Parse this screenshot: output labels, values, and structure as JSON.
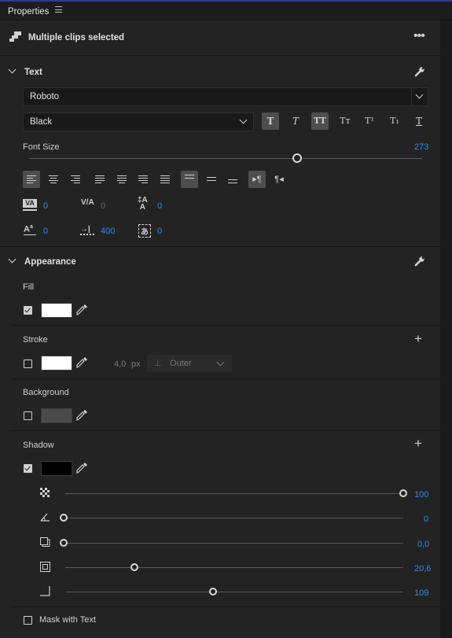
{
  "header": {
    "title": "Properties"
  },
  "selection": {
    "label": "Multiple clips selected"
  },
  "text_section": {
    "title": "Text",
    "font_family": "Roboto",
    "font_style": "Black",
    "style_buttons": [
      "T",
      "T",
      "TT",
      "Tт",
      "T¹",
      "T₁",
      "T"
    ],
    "font_size_label": "Font Size",
    "font_size_value": "273",
    "font_size_level": 0.63,
    "kerning": "0",
    "tracking": "0",
    "leading": "0",
    "baseline_shift": "0",
    "tab_width": "400",
    "tsume": "0"
  },
  "appearance": {
    "title": "Appearance",
    "fill": {
      "label": "Fill",
      "checked": true,
      "color": "#ffffff"
    },
    "stroke": {
      "label": "Stroke",
      "checked": false,
      "color": "#ffffff",
      "width": "4,0",
      "unit": "px",
      "position": "Outer"
    },
    "background": {
      "label": "Background",
      "checked": false,
      "color": "#4a4a4a"
    },
    "shadow": {
      "label": "Shadow",
      "checked": true,
      "color": "#000000",
      "opacity": "100",
      "angle": "0",
      "distance": "0,0",
      "size": "20,6",
      "blur": "109"
    },
    "mask": {
      "label": "Mask with Text",
      "checked": false
    }
  },
  "colors": {
    "accent": "#2d8ceb",
    "background": "#232323"
  }
}
